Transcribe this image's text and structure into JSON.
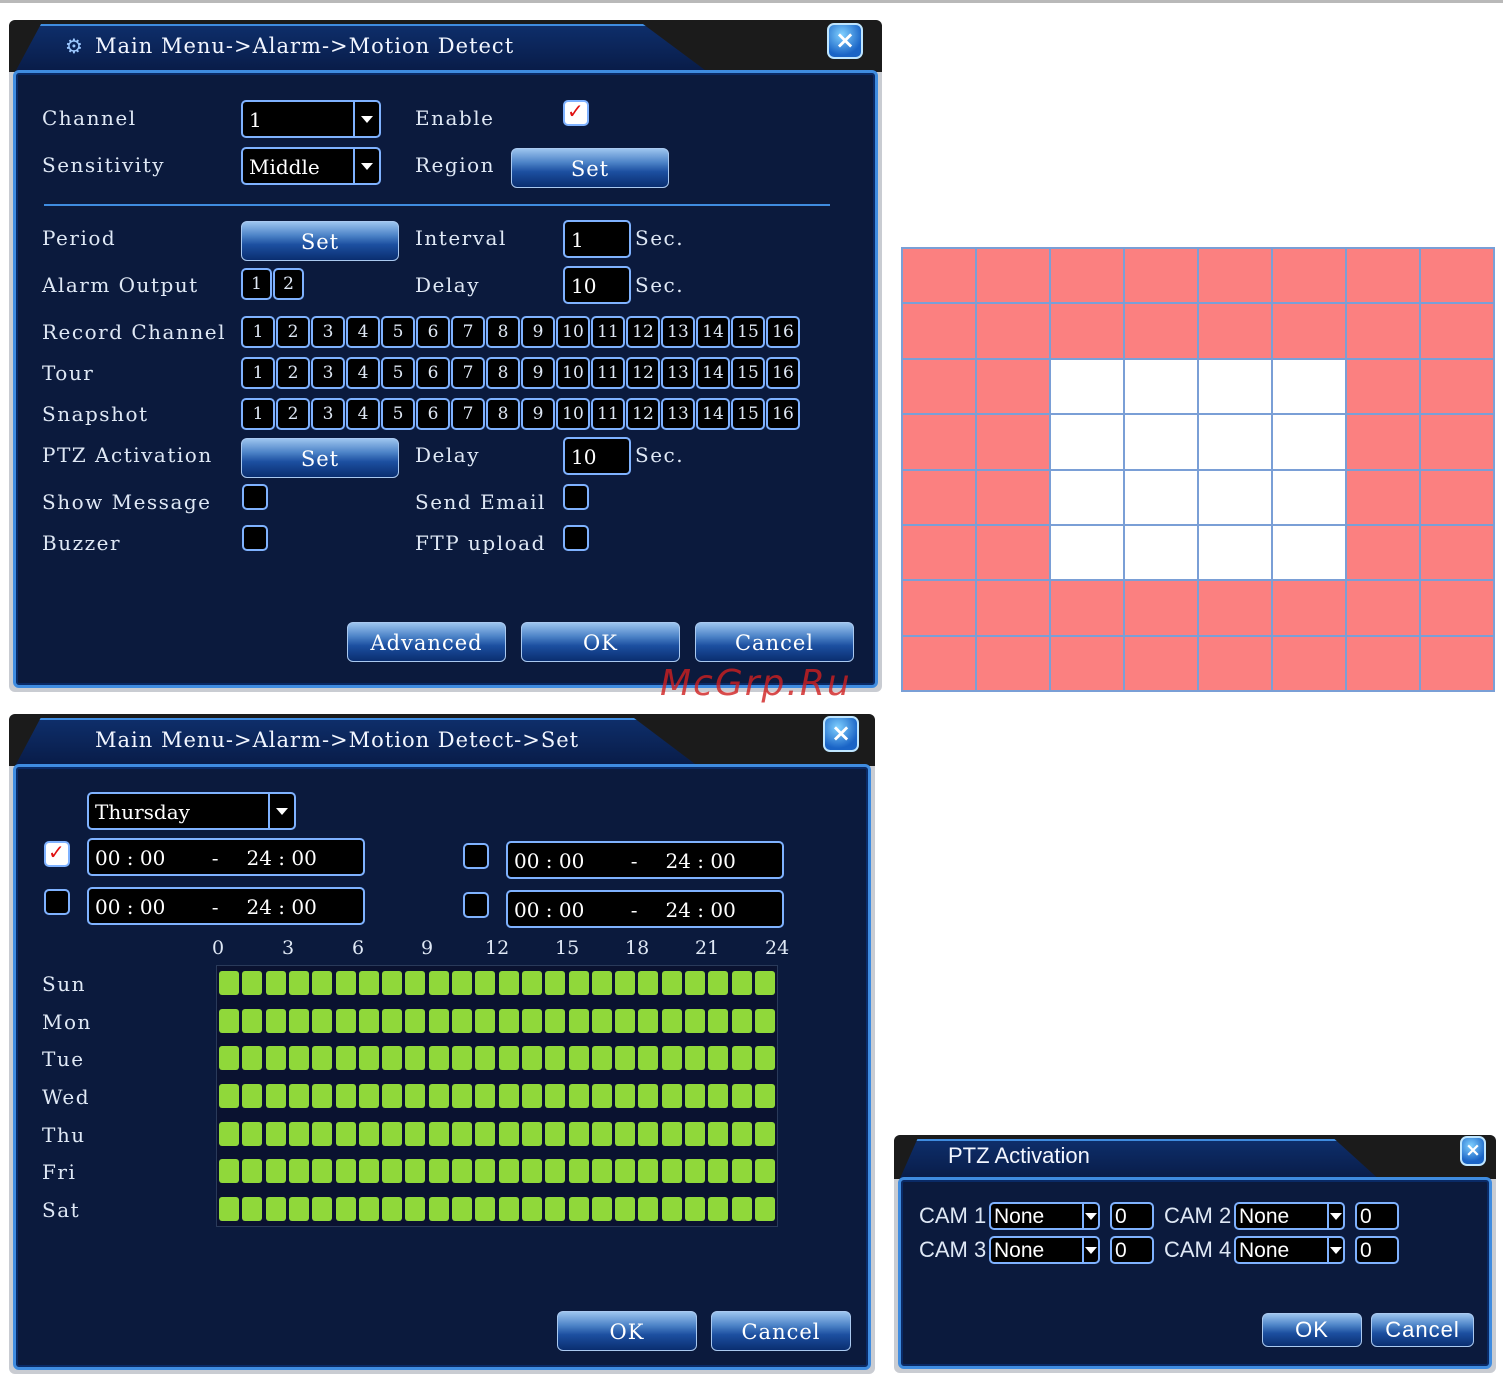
{
  "motion_detect": {
    "title": "Main Menu->Alarm->Motion Detect",
    "close_label": "×",
    "channel_label": "Channel",
    "channel_value": "1",
    "enable_label": "Enable",
    "enable_checked": true,
    "sensitivity_label": "Sensitivity",
    "sensitivity_value": "Middle",
    "region_label": "Region",
    "region_button": "Set",
    "period_label": "Period",
    "period_button": "Set",
    "interval_label": "Interval",
    "interval_value": "1",
    "interval_unit": "Sec.",
    "alarm_output_label": "Alarm Output",
    "alarm_outputs": [
      "1",
      "2"
    ],
    "delay_label": "Delay",
    "delay_value": "10",
    "delay_unit": "Sec.",
    "record_channel_label": "Record Channel",
    "tour_label": "Tour",
    "snapshot_label": "Snapshot",
    "channels": [
      "1",
      "2",
      "3",
      "4",
      "5",
      "6",
      "7",
      "8",
      "9",
      "10",
      "11",
      "12",
      "13",
      "14",
      "15",
      "16"
    ],
    "ptz_label": "PTZ Activation",
    "ptz_button": "Set",
    "ptz_delay_label": "Delay",
    "ptz_delay_value": "10",
    "ptz_delay_unit": "Sec.",
    "show_message_label": "Show Message",
    "send_email_label": "Send Email",
    "buzzer_label": "Buzzer",
    "ftp_label": "FTP upload",
    "advanced_button": "Advanced",
    "ok_button": "OK",
    "cancel_button": "Cancel"
  },
  "watermark": "McGrp.Ru",
  "region_grid": {
    "columns": 8,
    "rows": 8,
    "cells": [
      "rrrrrrrr",
      "rrrrrrrr",
      "rrwwwwrr",
      "rrwwwwrr",
      "rrwwwwrr",
      "rrwwwwrr",
      "rrrrrrrr",
      "rrrrrrrr"
    ],
    "selected_color": "#fb8080",
    "unselected_color": "#ffffff"
  },
  "period_set": {
    "title": "Main Menu->Alarm->Motion Detect->Set",
    "close_label": "×",
    "day_value": "Thursday",
    "periods": [
      {
        "checked": true,
        "start_h": "00",
        "start_m": "00",
        "end_h": "24",
        "end_m": "00"
      },
      {
        "checked": false,
        "start_h": "00",
        "start_m": "00",
        "end_h": "24",
        "end_m": "00"
      },
      {
        "checked": false,
        "start_h": "00",
        "start_m": "00",
        "end_h": "24",
        "end_m": "00"
      },
      {
        "checked": false,
        "start_h": "00",
        "start_m": "00",
        "end_h": "24",
        "end_m": "00"
      }
    ],
    "hour_labels": [
      "0",
      "3",
      "6",
      "9",
      "12",
      "15",
      "18",
      "21",
      "24"
    ],
    "days": [
      "Sun",
      "Mon",
      "Tue",
      "Wed",
      "Thu",
      "Fri",
      "Sat"
    ],
    "active_color": "#90d83a",
    "ok_button": "OK",
    "cancel_button": "Cancel"
  },
  "ptz_activation": {
    "title": "PTZ Activation",
    "close_label": "×",
    "cams": [
      {
        "label": "CAM 1",
        "type": "None",
        "value": "0"
      },
      {
        "label": "CAM 2",
        "type": "None",
        "value": "0"
      },
      {
        "label": "CAM 3",
        "type": "None",
        "value": "0"
      },
      {
        "label": "CAM 4",
        "type": "None",
        "value": "0"
      }
    ],
    "ok_button": "OK",
    "cancel_button": "Cancel"
  }
}
